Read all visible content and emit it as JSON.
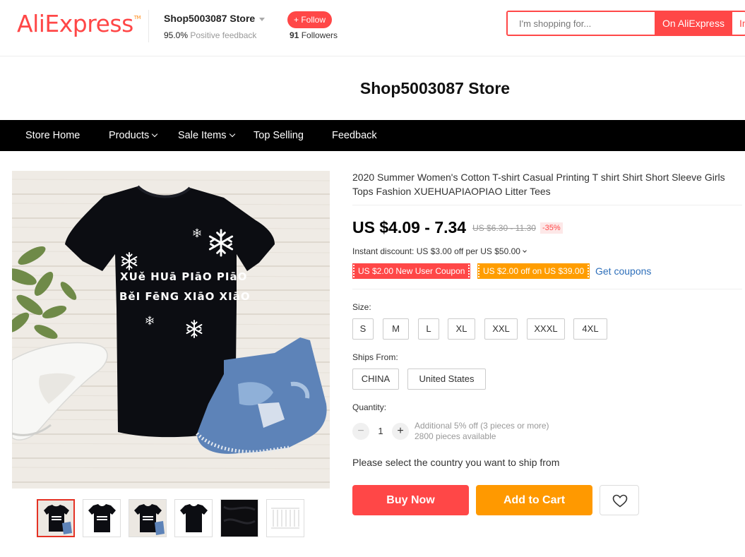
{
  "header": {
    "logo_main": "AliExpress",
    "logo_tm": "TM",
    "store_name": "Shop5003087 Store",
    "feedback_percent": "95.0%",
    "feedback_label": "Positive feedback",
    "follow_label": "+ Follow",
    "followers_count": "91",
    "followers_label": "Followers",
    "search_placeholder": "I'm shopping for...",
    "search_button_ali": "On AliExpress",
    "search_button_store": "In"
  },
  "store_banner": {
    "title": "Shop5003087 Store"
  },
  "nav": {
    "items": [
      {
        "label": "Store Home",
        "has_dropdown": false
      },
      {
        "label": "Products",
        "has_dropdown": true
      },
      {
        "label": "Sale Items",
        "has_dropdown": true
      },
      {
        "label": "Top Selling",
        "has_dropdown": false
      },
      {
        "label": "Feedback",
        "has_dropdown": false
      }
    ]
  },
  "gallery": {
    "shirt_text_line1": "XUě HUā PIāO PIāO",
    "shirt_text_line2": "BěI FēNG XIāO XIāO",
    "selected_thumb": 1,
    "thumbs": [
      "thumb-1",
      "thumb-2",
      "thumb-3",
      "thumb-4",
      "thumb-5",
      "thumb-6"
    ]
  },
  "product": {
    "title": "2020 Summer Women's Cotton T-shirt Casual Printing T shirt Shirt Short Sleeve Girls Tops Fashion XUEHUAPIAOPIAO Litter Tees",
    "price_current": "US $4.09 - 7.34",
    "price_original": "US $6.30 - 11.30",
    "discount": "-35%",
    "instant_discount": "Instant discount: US $3.00 off per US $50.00",
    "coupon_new_user": "US $2.00 New User Coupon",
    "coupon_off": "US $2.00 off on US $39.00",
    "get_coupons": "Get coupons",
    "size_label": "Size:",
    "sizes": [
      "S",
      "M",
      "L",
      "XL",
      "XXL",
      "XXXL",
      "4XL"
    ],
    "ships_from_label": "Ships From:",
    "ships_from": [
      "CHINA",
      "United States"
    ],
    "quantity_label": "Quantity:",
    "quantity": "1",
    "quantity_minus": "−",
    "quantity_plus": "+",
    "additional_discount": "Additional 5% off (3 pieces or more)",
    "available": "2800 pieces available",
    "ship_note": "Please select the country you want to ship from",
    "buy_now": "Buy Now",
    "add_to_cart": "Add to Cart"
  },
  "colors": {
    "brand_red": "#ff4747",
    "brand_orange": "#ff8c1a",
    "coupon_orange": "#ff9d00",
    "cart_orange": "#ff9900",
    "nav_bg": "#000000",
    "link_blue": "#2e6fba"
  },
  "icons": [
    "caret-down-icon",
    "chevron-down-icon",
    "heart-icon",
    "snowflake-icon"
  ]
}
